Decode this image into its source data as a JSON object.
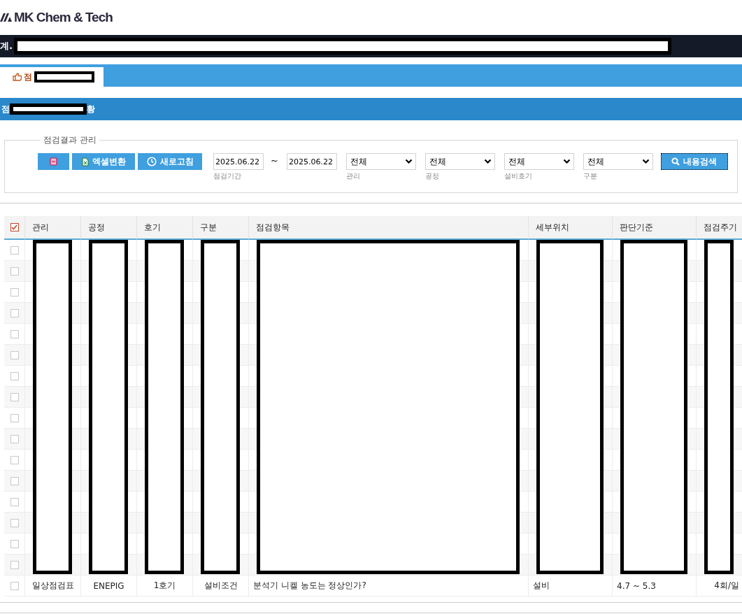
{
  "logo": {
    "text": "MK Chem & Tech"
  },
  "top_bar": {
    "text": "계.",
    "redacted": true
  },
  "tabs": [
    {
      "label": "점",
      "selected": true,
      "redacted": true
    }
  ],
  "section_title": {
    "start": "점",
    "end": "황",
    "redacted": true
  },
  "filter": {
    "legend": "점검결과 관리",
    "buttons": [
      {
        "kind": "delete"
      },
      {
        "kind": "excel",
        "label": "엑셀변환"
      },
      {
        "kind": "refresh",
        "label": "새로고침"
      }
    ],
    "date_from": "2025.06.22",
    "range_sep": "~",
    "date_to": "2025.06.22",
    "date_label": "점검기간",
    "selects": [
      {
        "value": "전체",
        "label": "관리"
      },
      {
        "value": "전체",
        "label": "공정"
      },
      {
        "value": "전체",
        "label": "설비호기"
      },
      {
        "value": "전체",
        "label": "구분"
      }
    ],
    "search_button": "내용검색"
  },
  "table": {
    "select_all": {
      "checked": true
    },
    "columns": [
      {
        "label": "관리",
        "redacted": true
      },
      {
        "label": "공정",
        "redacted": true
      },
      {
        "label": "호기",
        "redacted": true
      },
      {
        "label": "구분",
        "redacted": true
      },
      {
        "label": "점검항목",
        "redacted": true
      },
      {
        "label": "세부위치",
        "redacted": true
      },
      {
        "label": "판단기준",
        "redacted": true
      },
      {
        "label": "점검주기",
        "redacted": true
      }
    ],
    "rows": [
      {
        "checked": false
      },
      {
        "checked": false
      },
      {
        "checked": false
      },
      {
        "checked": false
      },
      {
        "checked": false
      },
      {
        "checked": false
      },
      {
        "checked": false
      },
      {
        "checked": false
      },
      {
        "checked": false
      },
      {
        "checked": false
      },
      {
        "checked": false
      },
      {
        "checked": false
      },
      {
        "checked": false
      },
      {
        "checked": false
      },
      {
        "checked": false
      },
      {
        "checked": false
      },
      {
        "checked": false,
        "cells": [
          "일상점검표",
          "ENEPIG",
          "1호기",
          "설비조건",
          "분석기 니켈 농도는 정상인가?",
          "설비",
          "4.7 ~ 5.3",
          "4회/일"
        ]
      }
    ]
  }
}
